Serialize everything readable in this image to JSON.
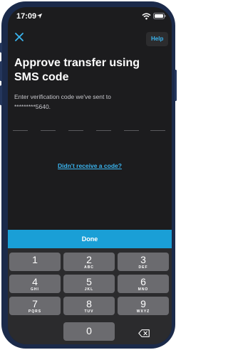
{
  "status_bar": {
    "time": "17:09"
  },
  "header": {
    "help_label": "Help"
  },
  "main": {
    "title": "Approve transfer using SMS code",
    "subtitle_line1": "Enter verification code we've sent to",
    "subtitle_line2": "*********5640.",
    "code_length": 6,
    "resend_link": "Didn't receive a code?"
  },
  "done_label": "Done",
  "keypad": {
    "keys": [
      {
        "num": "1",
        "letters": ""
      },
      {
        "num": "2",
        "letters": "ABC"
      },
      {
        "num": "3",
        "letters": "DEF"
      },
      {
        "num": "4",
        "letters": "GHI"
      },
      {
        "num": "5",
        "letters": "JKL"
      },
      {
        "num": "6",
        "letters": "MNO"
      },
      {
        "num": "7",
        "letters": "PQRS"
      },
      {
        "num": "8",
        "letters": "TUV"
      },
      {
        "num": "9",
        "letters": "WXYZ"
      },
      {
        "num": "0",
        "letters": ""
      }
    ]
  },
  "icons": {
    "close": "close-icon",
    "backspace": "backspace-icon",
    "wifi": "wifi-icon",
    "battery": "battery-icon",
    "location": "location-arrow-icon"
  },
  "colors": {
    "accent": "#3ab5f0",
    "done_button": "#1a9fd6",
    "screen_bg": "#1c1c1e",
    "key_bg": "#6b6b6f",
    "frame": "#1b2a4a"
  }
}
